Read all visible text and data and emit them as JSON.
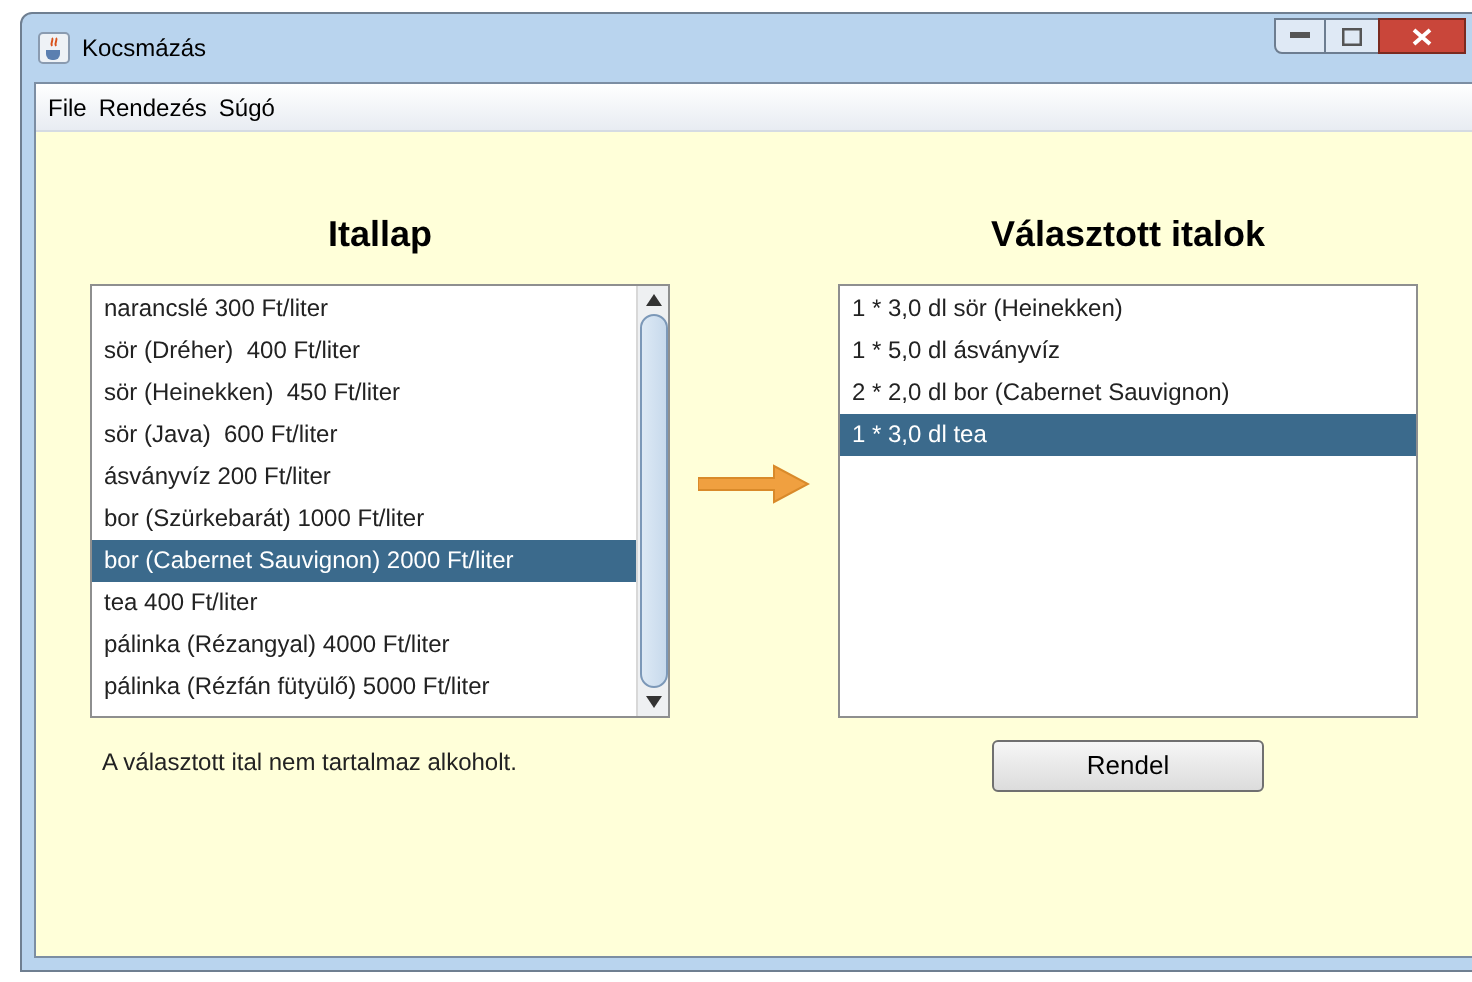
{
  "window": {
    "title": "Kocsmázás"
  },
  "menu": [
    "File",
    "Rendezés",
    "Súgó"
  ],
  "left": {
    "heading": "Itallap",
    "items": [
      {
        "label": "narancslé 300 Ft/liter",
        "selected": false
      },
      {
        "label": "sör (Dréher)  400 Ft/liter",
        "selected": false
      },
      {
        "label": "sör (Heinekken)  450 Ft/liter",
        "selected": false
      },
      {
        "label": "sör (Java)  600 Ft/liter",
        "selected": false
      },
      {
        "label": "ásványvíz 200 Ft/liter",
        "selected": false
      },
      {
        "label": "bor (Szürkebarát) 1000 Ft/liter",
        "selected": false
      },
      {
        "label": "bor (Cabernet Sauvignon) 2000 Ft/liter",
        "selected": true
      },
      {
        "label": "tea 400 Ft/liter",
        "selected": false
      },
      {
        "label": "pálinka (Rézangyal) 4000 Ft/liter",
        "selected": false
      },
      {
        "label": "pálinka (Rézfán fütyülő) 5000 Ft/liter",
        "selected": false
      }
    ],
    "status": "A választott ital nem tartalmaz alkoholt."
  },
  "right": {
    "heading": "Választott italok",
    "items": [
      {
        "label": "1 * 3,0 dl sör (Heinekken)",
        "selected": false
      },
      {
        "label": "1 * 5,0 dl ásványvíz",
        "selected": false
      },
      {
        "label": "2 * 2,0 dl bor (Cabernet Sauvignon)",
        "selected": false
      },
      {
        "label": "1 * 3,0 dl tea",
        "selected": true
      }
    ],
    "button": "Rendel"
  }
}
